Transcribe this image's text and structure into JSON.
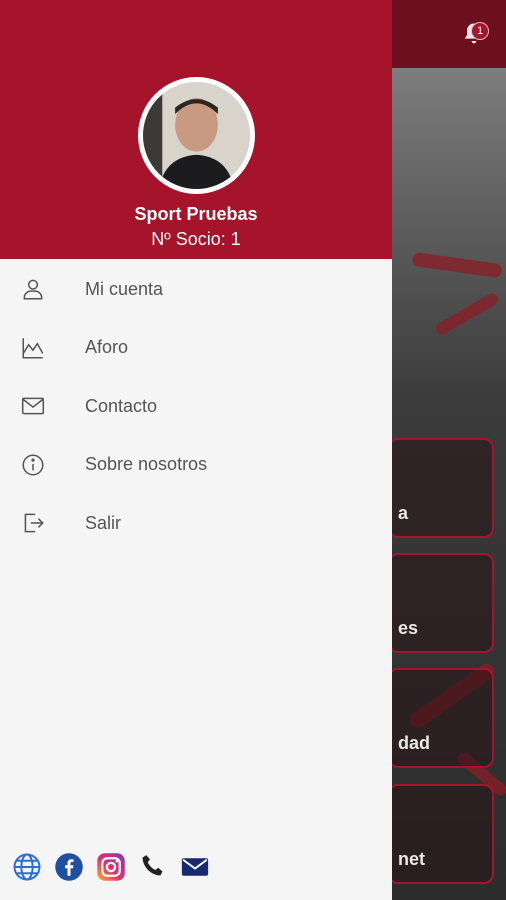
{
  "notifications": {
    "count": "1"
  },
  "background_cards": [
    {
      "label": "a"
    },
    {
      "label": "es"
    },
    {
      "label": "dad"
    },
    {
      "label": "net"
    }
  ],
  "profile": {
    "name": "Sport Pruebas",
    "member_number": "Nº Socio: 1"
  },
  "menu": {
    "items": [
      {
        "label": "Mi cuenta",
        "icon": "user-icon"
      },
      {
        "label": "Aforo",
        "icon": "area-chart-icon"
      },
      {
        "label": "Contacto",
        "icon": "mail-icon"
      },
      {
        "label": "Sobre nosotros",
        "icon": "info-icon"
      },
      {
        "label": "Salir",
        "icon": "logout-icon"
      }
    ]
  },
  "social": [
    "globe-icon",
    "facebook-icon",
    "instagram-icon",
    "phone-icon",
    "email-icon"
  ],
  "colors": {
    "brand": "#a5142b",
    "drawer_bg": "#f5f5f5",
    "menu_text": "#555555"
  }
}
